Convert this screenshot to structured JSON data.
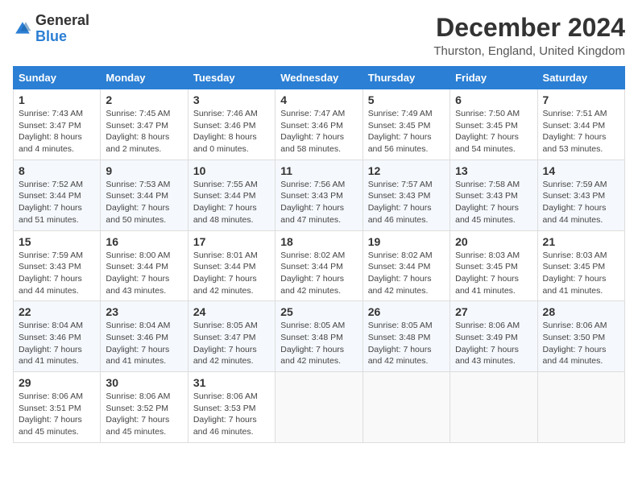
{
  "logo": {
    "text_general": "General",
    "text_blue": "Blue"
  },
  "header": {
    "month_title": "December 2024",
    "location": "Thurston, England, United Kingdom"
  },
  "columns": [
    "Sunday",
    "Monday",
    "Tuesday",
    "Wednesday",
    "Thursday",
    "Friday",
    "Saturday"
  ],
  "weeks": [
    [
      {
        "day": "1",
        "sunrise": "Sunrise: 7:43 AM",
        "sunset": "Sunset: 3:47 PM",
        "daylight": "Daylight: 8 hours and 4 minutes."
      },
      {
        "day": "2",
        "sunrise": "Sunrise: 7:45 AM",
        "sunset": "Sunset: 3:47 PM",
        "daylight": "Daylight: 8 hours and 2 minutes."
      },
      {
        "day": "3",
        "sunrise": "Sunrise: 7:46 AM",
        "sunset": "Sunset: 3:46 PM",
        "daylight": "Daylight: 8 hours and 0 minutes."
      },
      {
        "day": "4",
        "sunrise": "Sunrise: 7:47 AM",
        "sunset": "Sunset: 3:46 PM",
        "daylight": "Daylight: 7 hours and 58 minutes."
      },
      {
        "day": "5",
        "sunrise": "Sunrise: 7:49 AM",
        "sunset": "Sunset: 3:45 PM",
        "daylight": "Daylight: 7 hours and 56 minutes."
      },
      {
        "day": "6",
        "sunrise": "Sunrise: 7:50 AM",
        "sunset": "Sunset: 3:45 PM",
        "daylight": "Daylight: 7 hours and 54 minutes."
      },
      {
        "day": "7",
        "sunrise": "Sunrise: 7:51 AM",
        "sunset": "Sunset: 3:44 PM",
        "daylight": "Daylight: 7 hours and 53 minutes."
      }
    ],
    [
      {
        "day": "8",
        "sunrise": "Sunrise: 7:52 AM",
        "sunset": "Sunset: 3:44 PM",
        "daylight": "Daylight: 7 hours and 51 minutes."
      },
      {
        "day": "9",
        "sunrise": "Sunrise: 7:53 AM",
        "sunset": "Sunset: 3:44 PM",
        "daylight": "Daylight: 7 hours and 50 minutes."
      },
      {
        "day": "10",
        "sunrise": "Sunrise: 7:55 AM",
        "sunset": "Sunset: 3:44 PM",
        "daylight": "Daylight: 7 hours and 48 minutes."
      },
      {
        "day": "11",
        "sunrise": "Sunrise: 7:56 AM",
        "sunset": "Sunset: 3:43 PM",
        "daylight": "Daylight: 7 hours and 47 minutes."
      },
      {
        "day": "12",
        "sunrise": "Sunrise: 7:57 AM",
        "sunset": "Sunset: 3:43 PM",
        "daylight": "Daylight: 7 hours and 46 minutes."
      },
      {
        "day": "13",
        "sunrise": "Sunrise: 7:58 AM",
        "sunset": "Sunset: 3:43 PM",
        "daylight": "Daylight: 7 hours and 45 minutes."
      },
      {
        "day": "14",
        "sunrise": "Sunrise: 7:59 AM",
        "sunset": "Sunset: 3:43 PM",
        "daylight": "Daylight: 7 hours and 44 minutes."
      }
    ],
    [
      {
        "day": "15",
        "sunrise": "Sunrise: 7:59 AM",
        "sunset": "Sunset: 3:43 PM",
        "daylight": "Daylight: 7 hours and 44 minutes."
      },
      {
        "day": "16",
        "sunrise": "Sunrise: 8:00 AM",
        "sunset": "Sunset: 3:44 PM",
        "daylight": "Daylight: 7 hours and 43 minutes."
      },
      {
        "day": "17",
        "sunrise": "Sunrise: 8:01 AM",
        "sunset": "Sunset: 3:44 PM",
        "daylight": "Daylight: 7 hours and 42 minutes."
      },
      {
        "day": "18",
        "sunrise": "Sunrise: 8:02 AM",
        "sunset": "Sunset: 3:44 PM",
        "daylight": "Daylight: 7 hours and 42 minutes."
      },
      {
        "day": "19",
        "sunrise": "Sunrise: 8:02 AM",
        "sunset": "Sunset: 3:44 PM",
        "daylight": "Daylight: 7 hours and 42 minutes."
      },
      {
        "day": "20",
        "sunrise": "Sunrise: 8:03 AM",
        "sunset": "Sunset: 3:45 PM",
        "daylight": "Daylight: 7 hours and 41 minutes."
      },
      {
        "day": "21",
        "sunrise": "Sunrise: 8:03 AM",
        "sunset": "Sunset: 3:45 PM",
        "daylight": "Daylight: 7 hours and 41 minutes."
      }
    ],
    [
      {
        "day": "22",
        "sunrise": "Sunrise: 8:04 AM",
        "sunset": "Sunset: 3:46 PM",
        "daylight": "Daylight: 7 hours and 41 minutes."
      },
      {
        "day": "23",
        "sunrise": "Sunrise: 8:04 AM",
        "sunset": "Sunset: 3:46 PM",
        "daylight": "Daylight: 7 hours and 41 minutes."
      },
      {
        "day": "24",
        "sunrise": "Sunrise: 8:05 AM",
        "sunset": "Sunset: 3:47 PM",
        "daylight": "Daylight: 7 hours and 42 minutes."
      },
      {
        "day": "25",
        "sunrise": "Sunrise: 8:05 AM",
        "sunset": "Sunset: 3:48 PM",
        "daylight": "Daylight: 7 hours and 42 minutes."
      },
      {
        "day": "26",
        "sunrise": "Sunrise: 8:05 AM",
        "sunset": "Sunset: 3:48 PM",
        "daylight": "Daylight: 7 hours and 42 minutes."
      },
      {
        "day": "27",
        "sunrise": "Sunrise: 8:06 AM",
        "sunset": "Sunset: 3:49 PM",
        "daylight": "Daylight: 7 hours and 43 minutes."
      },
      {
        "day": "28",
        "sunrise": "Sunrise: 8:06 AM",
        "sunset": "Sunset: 3:50 PM",
        "daylight": "Daylight: 7 hours and 44 minutes."
      }
    ],
    [
      {
        "day": "29",
        "sunrise": "Sunrise: 8:06 AM",
        "sunset": "Sunset: 3:51 PM",
        "daylight": "Daylight: 7 hours and 45 minutes."
      },
      {
        "day": "30",
        "sunrise": "Sunrise: 8:06 AM",
        "sunset": "Sunset: 3:52 PM",
        "daylight": "Daylight: 7 hours and 45 minutes."
      },
      {
        "day": "31",
        "sunrise": "Sunrise: 8:06 AM",
        "sunset": "Sunset: 3:53 PM",
        "daylight": "Daylight: 7 hours and 46 minutes."
      },
      null,
      null,
      null,
      null
    ]
  ]
}
